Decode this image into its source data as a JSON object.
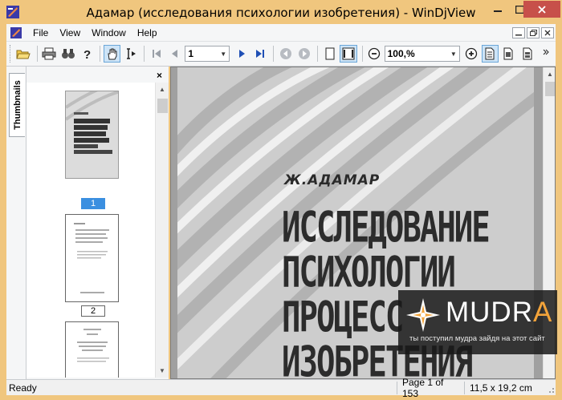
{
  "window": {
    "title": "Адамар (исследования психологии изобретения) - WinDjView"
  },
  "menu": {
    "items": [
      "File",
      "View",
      "Window",
      "Help"
    ]
  },
  "toolbar": {
    "page_value": "1",
    "zoom_value": "100,%"
  },
  "sidebar": {
    "tab_label": "Thumbnails",
    "close_glyph": "×",
    "thumbnails": [
      {
        "label": "1",
        "selected": true
      },
      {
        "label": "2",
        "selected": false
      }
    ]
  },
  "document": {
    "author": "Ж.АДАМАР",
    "title_lines": [
      "ИССЛЕДОВАНИЕ",
      "ПСИХОЛОГИИ",
      "ПРОЦЕСС",
      "ИЗОБРЕТЕНИЯ"
    ]
  },
  "watermark": {
    "brand_main": "MUDR",
    "brand_accent": "A",
    "tagline": "ты поступил мудра зайдя на этот сайт"
  },
  "status": {
    "ready": "Ready",
    "page_info": "Page 1 of 153",
    "page_size": "11,5 x 19,2 cm"
  },
  "colors": {
    "titlebar": "#f0c67e",
    "close_button": "#c7504a",
    "selection": "#3b8fe0",
    "watermark_accent": "#f2a33a"
  }
}
